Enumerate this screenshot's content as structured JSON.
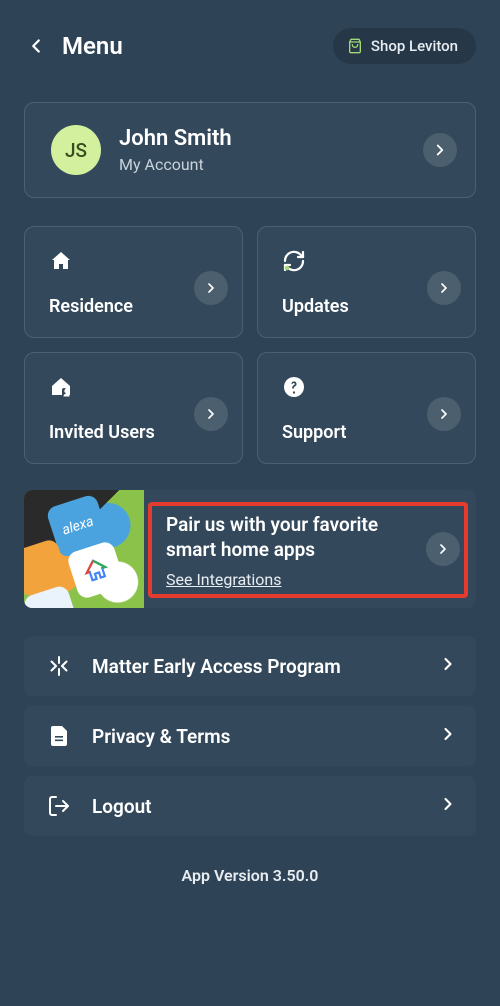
{
  "header": {
    "title": "Menu",
    "shop_label": "Shop Leviton"
  },
  "account": {
    "initials": "JS",
    "name": "John Smith",
    "subtitle": "My Account"
  },
  "tiles": {
    "residence": "Residence",
    "updates": "Updates",
    "invited_users": "Invited Users",
    "support": "Support"
  },
  "promo": {
    "title": "Pair us with your favorite smart home apps",
    "link": "See Integrations"
  },
  "rows": {
    "matter": "Matter Early Access Program",
    "privacy": "Privacy & Terms",
    "logout": "Logout"
  },
  "version": "App Version 3.50.0"
}
